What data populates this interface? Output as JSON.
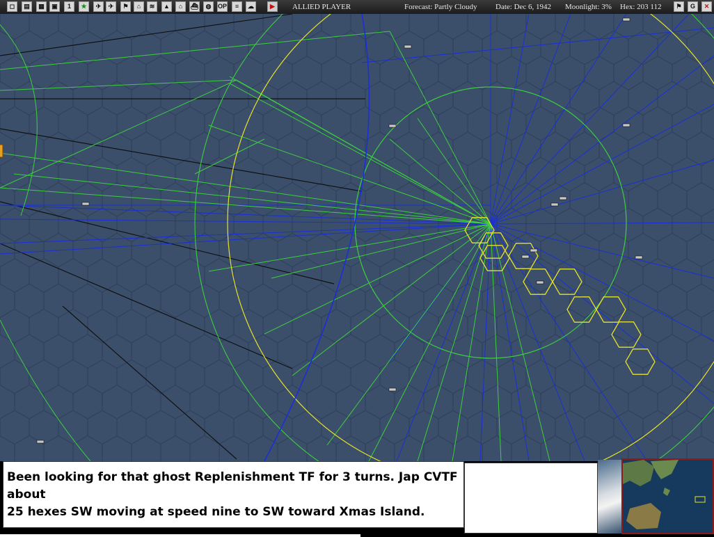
{
  "toolbar": {
    "buttons": [
      {
        "name": "cycle-unit-button",
        "glyph": "◻"
      },
      {
        "name": "report-button",
        "glyph": "▤"
      },
      {
        "name": "ships-report-button",
        "glyph": "▦"
      },
      {
        "name": "taskforce-report-button",
        "glyph": "▣"
      },
      {
        "name": "turn-number-button",
        "glyph": "1"
      },
      {
        "name": "star-button",
        "glyph": "★"
      },
      {
        "name": "fighter-button",
        "glyph": "✈"
      },
      {
        "name": "bomber-button",
        "glyph": "✈"
      },
      {
        "name": "flag-button",
        "glyph": "⚑"
      },
      {
        "name": "base-button",
        "glyph": "⌂"
      },
      {
        "name": "route-button",
        "glyph": "≋"
      },
      {
        "name": "ground-button",
        "glyph": "▲"
      },
      {
        "name": "hq-button",
        "glyph": "⌂"
      },
      {
        "name": "ship-button",
        "glyph": "⛴"
      },
      {
        "name": "globe-button",
        "glyph": "◍"
      },
      {
        "name": "ops-button",
        "glyph": "OP"
      },
      {
        "name": "list-button",
        "glyph": "≡"
      },
      {
        "name": "weather-button",
        "glyph": "☁"
      },
      {
        "name": "end-turn-button",
        "glyph": "▶"
      }
    ],
    "player": "ALLIED PLAYER",
    "forecast": "Forecast: Partly Cloudy",
    "date": "Date: Dec 6, 1942",
    "moonlight": "Moonlight: 3%",
    "hex": "Hex: 203 112",
    "right_buttons": [
      {
        "name": "flag-menu-button",
        "glyph": "⚑"
      },
      {
        "name": "g-button",
        "glyph": "G"
      },
      {
        "name": "close-button",
        "glyph": "✕"
      }
    ]
  },
  "message": {
    "line1": "Been looking for that ghost Replenishment TF for 3 turns.  Jap CVTF about",
    "line2": "25 hexes SW moving at speed nine to SW toward Xmas Island."
  },
  "colors": {
    "ocean": "#3b4f6b",
    "hex_grid": "#2c3d58",
    "green_line": "#3dcf3d",
    "blue_line": "#1a2fd6",
    "yellow_line": "#e6e22a",
    "black_line": "#111111"
  }
}
